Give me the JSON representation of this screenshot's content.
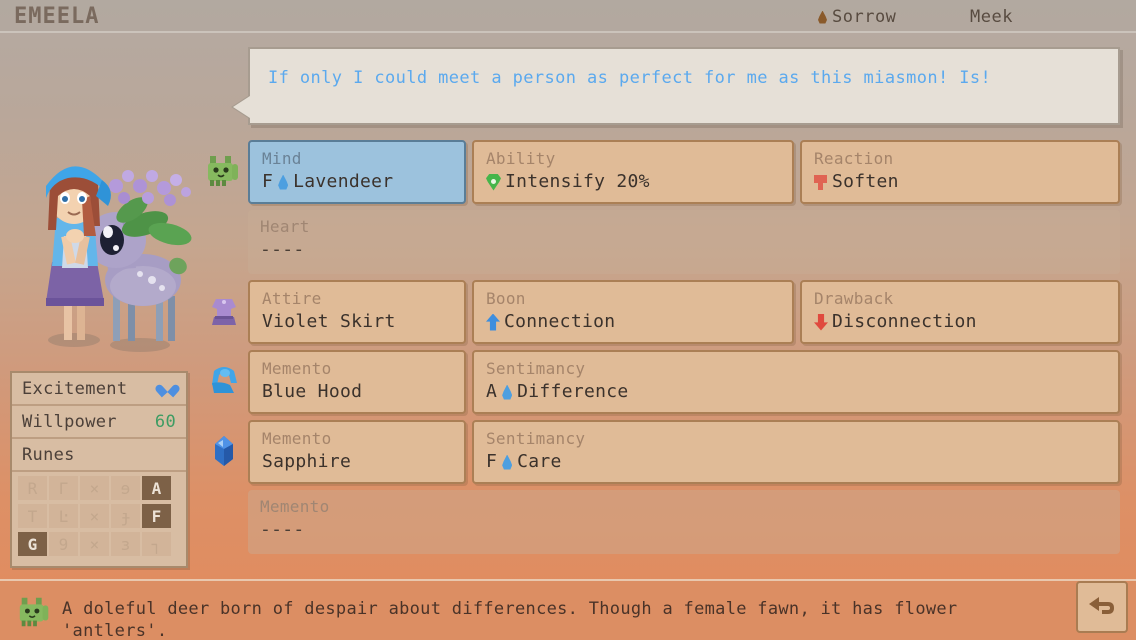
{
  "window": {
    "title": "Emeela"
  },
  "topbar": {
    "game_title": "EMEELA",
    "stats": [
      {
        "id": "sorrow",
        "label": "Sorrow",
        "icon": "water-drop-icon"
      },
      {
        "id": "meek",
        "label": "Meek",
        "icon": "none"
      }
    ]
  },
  "speech": {
    "text": "If only I could meet a person as perfect for me as this miasmon! Is!",
    "color": "#5ba9ee"
  },
  "left_panel": {
    "excitement_label": "Excitement",
    "excitement_icon": "blue-heart-icon",
    "willpower_label": "Willpower",
    "willpower_value": "60",
    "willpower_color": "#3e9c63",
    "runes_label": "Runes",
    "runes_rows": [
      {
        "cells": [
          "R",
          "Γ",
          "×",
          "ɘ",
          "A"
        ],
        "active_index": 4
      },
      {
        "cells": [
          "T",
          "Ŀ",
          "×",
          "ɟ",
          "F"
        ],
        "active_index": 4
      },
      {
        "cells": [
          "G",
          "9",
          "×",
          "ɜ",
          "┐"
        ],
        "active_index": 0
      }
    ]
  },
  "rows": [
    {
      "icon": "creature-icon",
      "left": {
        "label": "Mind",
        "value": "F Lavendeer",
        "prefix": "F",
        "element_icon": "water-drop-icon",
        "name": "Lavendeer",
        "selected": true
      },
      "middle": {
        "label": "Ability",
        "value": "Intensify 20%",
        "icon": "green-gem-icon"
      },
      "right": {
        "label": "Reaction",
        "value": "Soften",
        "icon": "red-funnel-icon"
      }
    },
    {
      "icon": "none",
      "full": {
        "label": "Heart",
        "value": "----",
        "empty": true
      }
    },
    {
      "icon": "violet-skirt-icon",
      "left": {
        "label": "Attire",
        "value": "Violet Skirt"
      },
      "middle": {
        "label": "Boon",
        "value": "Connection",
        "icon": "blue-up-arrow-icon"
      },
      "right": {
        "label": "Drawback",
        "value": "Disconnection",
        "icon": "red-down-arrow-icon"
      }
    },
    {
      "icon": "blue-hood-icon",
      "left": {
        "label": "Memento",
        "value": "Blue Hood"
      },
      "wide": {
        "label": "Sentimancy",
        "prefix": "A",
        "element_icon": "water-drop-icon",
        "name": "Difference",
        "value": "A Difference"
      }
    },
    {
      "icon": "sapphire-gem-icon",
      "left": {
        "label": "Memento",
        "value": "Sapphire"
      },
      "wide": {
        "label": "Sentimancy",
        "prefix": "F",
        "element_icon": "water-drop-icon",
        "name": "Care",
        "value": "F Care"
      }
    },
    {
      "icon": "none",
      "full": {
        "label": "Memento",
        "value": "----",
        "empty": true
      }
    }
  ],
  "description": {
    "icon": "creature-icon",
    "text": "A doleful deer born of despair about differences. Though a female fawn, it has flower 'antlers'."
  },
  "back_button": {
    "icon": "back-arrow-icon",
    "label": "Back"
  },
  "colors": {
    "card_bg": "#e0bb97",
    "card_border": "#ab7f55",
    "card_selected_bg": "#9cc2dd",
    "panel_bg": "#d8bda3",
    "desc_bar_bg": "#dc8e63",
    "speech_bg": "#e6e0d7",
    "speech_text": "#5ba9ee",
    "willpower": "#3e9c63",
    "boon_arrow": "#3e8ede",
    "drawback_arrow": "#e04a3e"
  }
}
